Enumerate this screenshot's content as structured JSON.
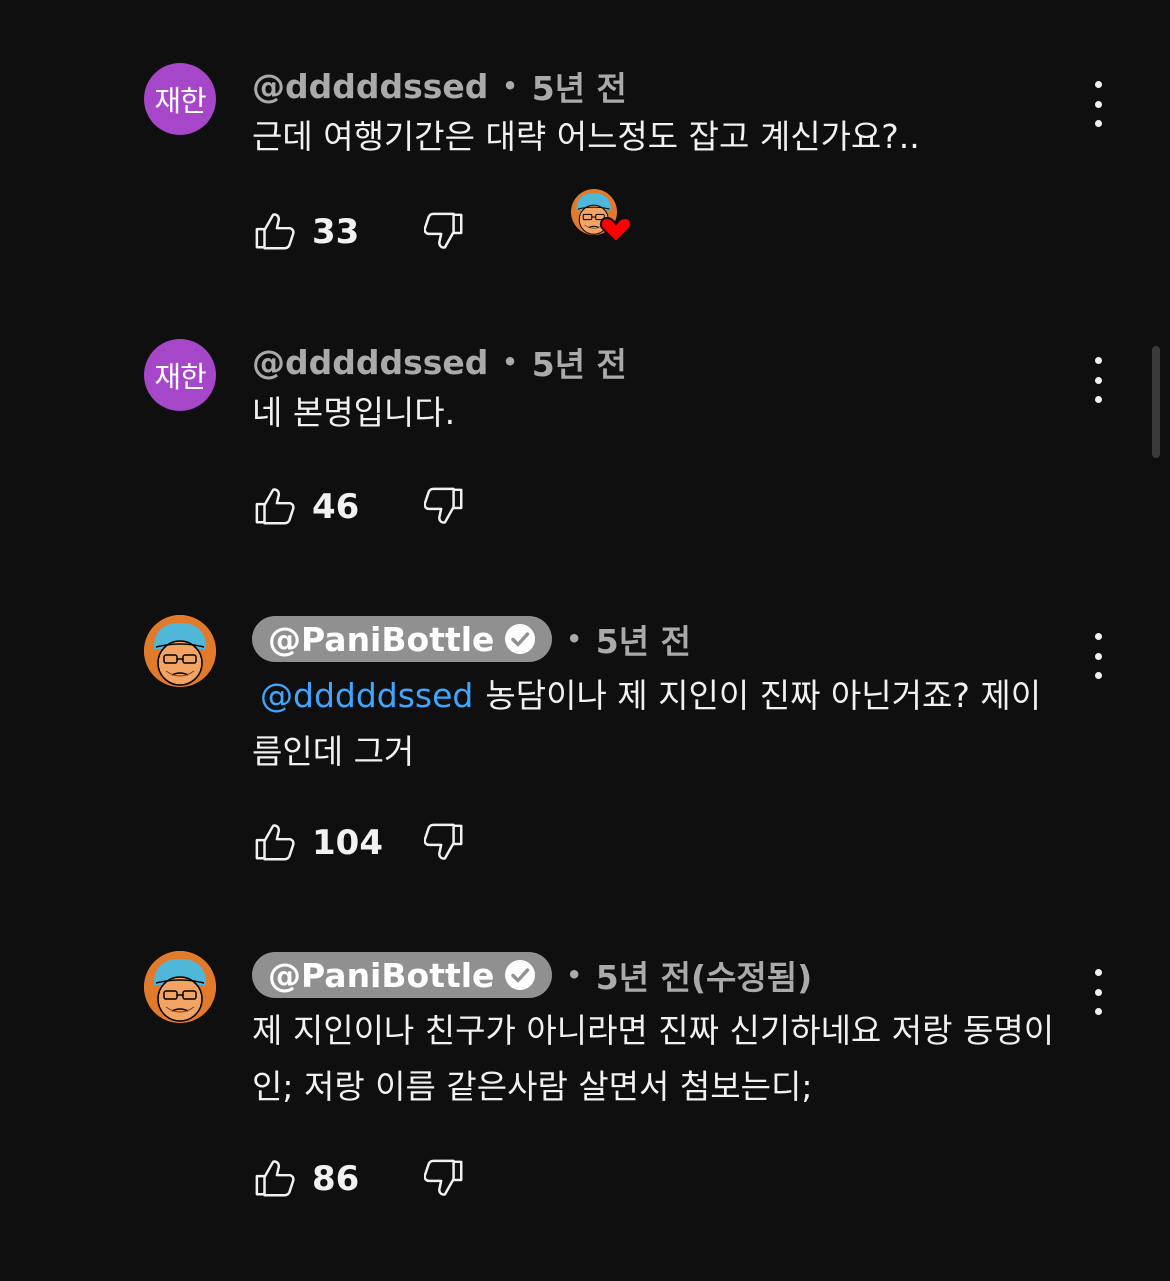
{
  "colors": {
    "background": "#0f0f0f",
    "text": "#f1f1f1",
    "meta": "#aaaaaa",
    "mention": "#3ea6ff",
    "avatar_letter_bg": "#a646c9",
    "creator_badge_bg": "#909090",
    "heart": "#ff0000"
  },
  "comments": [
    {
      "author": "@dddddssed",
      "avatar_text": "재한",
      "dot": "•",
      "time": "5년 전",
      "text": "근데 여행기간은 대략 어느정도 잡고 계신가요?..",
      "likes": "33",
      "hearted_by_creator": true,
      "icons": [
        "thumb-up-icon",
        "thumb-down-icon",
        "creator-heart-icon",
        "more-vert-icon"
      ]
    },
    {
      "author": "@dddddssed",
      "avatar_text": "재한",
      "dot": "•",
      "time": "5년 전",
      "text": "네 본명입니다.",
      "likes": "46",
      "icons": [
        "thumb-up-icon",
        "thumb-down-icon",
        "more-vert-icon"
      ]
    },
    {
      "author": "@PaniBottle",
      "verified": true,
      "dot": "•",
      "time": "5년 전",
      "mention": "@dddddssed",
      "text_line1": "농담이나 제 지인이 진짜 아닌거죠? 제이",
      "text_line2": "름인데 그거",
      "likes": "104",
      "icons": [
        "verified-check-icon",
        "thumb-up-icon",
        "thumb-down-icon",
        "more-vert-icon"
      ]
    },
    {
      "author": "@PaniBottle",
      "verified": true,
      "dot": "•",
      "time": "5년 전(수정됨)",
      "text_line1": "제 지인이나 친구가 아니라면 진짜 신기하네요 저랑 동명이",
      "text_line2": "인; 저랑 이름 같은사람 살면서 첨보는디;",
      "likes": "86",
      "icons": [
        "verified-check-icon",
        "thumb-up-icon",
        "thumb-down-icon",
        "more-vert-icon"
      ]
    }
  ]
}
